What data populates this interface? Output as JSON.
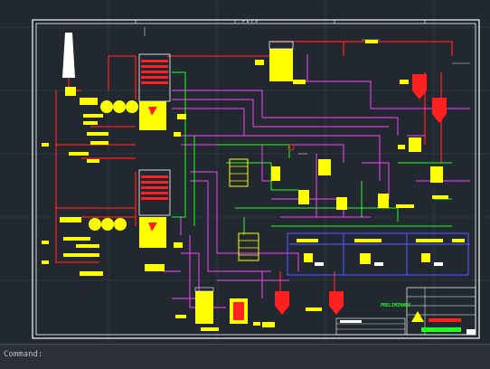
{
  "drawing": {
    "title_text": "PRELIMINARY",
    "frame_label": "P & I D"
  },
  "status_bar": {
    "command_prompt": "Command:",
    "coordinates": ""
  },
  "colors": {
    "background": "#212830",
    "frame": "#ffffff",
    "equipment": "#ffff00",
    "process_line_red": "#ff2020",
    "process_line_magenta": "#ff40ff",
    "process_line_green": "#20ff20",
    "process_line_blue": "#4040ff",
    "status_text": "#b8bcc4"
  }
}
